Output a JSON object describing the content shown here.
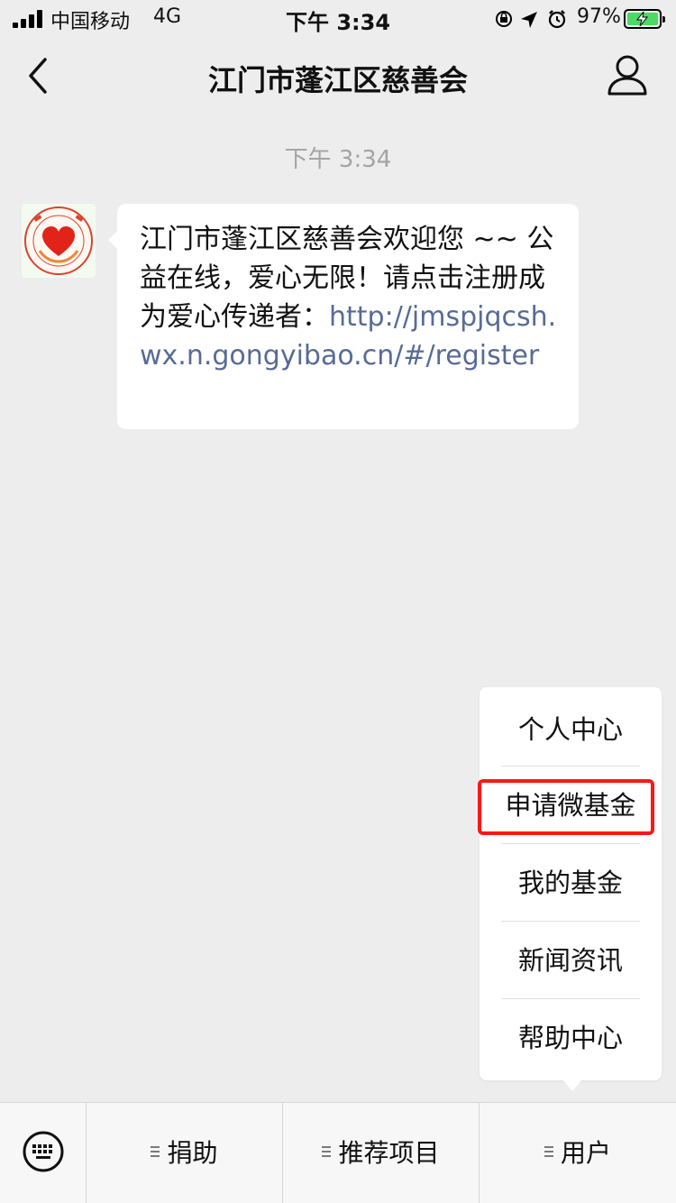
{
  "status_bar": {
    "carrier": "中国移动",
    "network": "4G",
    "time": "下午 3:34",
    "battery": "97%",
    "icons": [
      "orientation-lock-icon",
      "location-arrow-icon",
      "alarm-icon",
      "battery-charging-icon"
    ],
    "battery_level": 0.97
  },
  "nav": {
    "title": "江门市蓬江区慈善会",
    "back_icon": "chevron-left-icon",
    "profile_icon": "person-icon"
  },
  "chat": {
    "timestamp": "下午 3:34",
    "message": {
      "text": "江门市蓬江区慈善会欢迎您 ~~ 公益在线，爱心无限！请点击注册成为爱心传递者：",
      "link": "http://jmspjqcsh.wx.n.gongyibao.cn/#/register"
    }
  },
  "popup_menu": {
    "items": [
      "个人中心",
      "申请微基金",
      "我的基金",
      "新闻资讯",
      "帮助中心"
    ],
    "highlighted": "申请微基金"
  },
  "bottom_menu": {
    "keyboard_icon": "keyboard-icon",
    "tabs": [
      "捐助",
      "推荐项目",
      "用户"
    ]
  },
  "colors": {
    "background": "#ededed",
    "link": "#576b95",
    "highlight": "#ff1616",
    "battery": "#4cd964"
  }
}
